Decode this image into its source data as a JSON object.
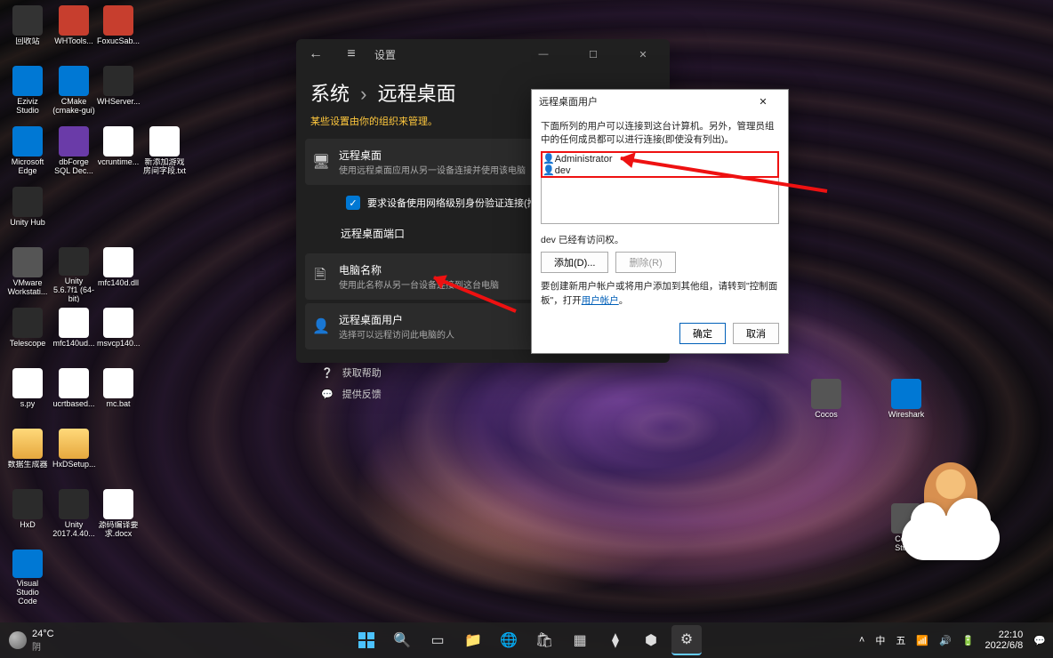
{
  "desktop": {
    "col1": [
      {
        "label": "回收站",
        "icon": "recycle"
      },
      {
        "label": "Eziviz Studio",
        "icon": "app-blue"
      },
      {
        "label": "Microsoft Edge",
        "icon": "app-blue"
      },
      {
        "label": "Unity Hub",
        "icon": "app-dark"
      },
      {
        "label": "VMware Workstati...",
        "icon": "app-grey"
      },
      {
        "label": "Telescope",
        "icon": "app-dark"
      },
      {
        "label": "s.py",
        "icon": "file"
      },
      {
        "label": "数据生成器",
        "icon": "folder"
      },
      {
        "label": "HxD",
        "icon": "app-dark"
      },
      {
        "label": "Visual Studio Code",
        "icon": "app-blue"
      }
    ],
    "col2": [
      {
        "label": "WHTools...",
        "icon": "app-red"
      },
      {
        "label": "CMake (cmake-gui)",
        "icon": "app-blue"
      },
      {
        "label": "dbForge SQL Dec...",
        "icon": "app-purple"
      },
      {
        "label": "",
        "icon": ""
      },
      {
        "label": "Unity 5.6.7f1 (64-bit)",
        "icon": "app-dark"
      },
      {
        "label": "mfc140ud...",
        "icon": "file"
      },
      {
        "label": "ucrtbased...",
        "icon": "file"
      },
      {
        "label": "HxDSetup...",
        "icon": "folder"
      },
      {
        "label": "Unity 2017.4.40...",
        "icon": "app-dark"
      }
    ],
    "col3": [
      {
        "label": "FoxucSab...",
        "icon": "app-red"
      },
      {
        "label": "WHServer...",
        "icon": "app-dark"
      },
      {
        "label": "vcruntime...",
        "icon": "file"
      },
      {
        "label": "",
        "icon": ""
      },
      {
        "label": "mfc140d.dll",
        "icon": "file"
      },
      {
        "label": "msvcp140...",
        "icon": "file"
      },
      {
        "label": "mc.bat",
        "icon": "file"
      },
      {
        "label": "",
        "icon": ""
      },
      {
        "label": "源码编译要求.docx",
        "icon": "file"
      }
    ],
    "col4": [
      {
        "label": "",
        "icon": ""
      },
      {
        "label": "",
        "icon": ""
      },
      {
        "label": "新添加游戏房间字段.txt",
        "icon": "file"
      }
    ],
    "right": [
      {
        "label": "Cocos",
        "icon": "app-grey"
      },
      {
        "label": "Wireshark",
        "icon": "app-blue"
      }
    ],
    "cocos2": {
      "label": "Cocos Studio",
      "icon": "app-grey"
    }
  },
  "settings": {
    "app_title": "设置",
    "breadcrumb_root": "系统",
    "breadcrumb_page": "远程桌面",
    "org_warning": "某些设置由你的组织来管理。",
    "rows": {
      "rd": {
        "title": "远程桌面",
        "sub": "使用远程桌面应用从另一设备连接并使用该电脑"
      },
      "nla": "要求设备使用网络级别身份验证连接(推荐)",
      "port": "远程桌面端口",
      "pcname": {
        "title": "电脑名称",
        "sub": "使用此名称从另一台设备连接到这台电脑"
      },
      "users": {
        "title": "远程桌面用户",
        "sub": "选择可以远程访问此电脑的人"
      }
    },
    "help": {
      "get": "获取帮助",
      "feedback": "提供反馈"
    }
  },
  "dialog": {
    "title": "远程桌面用户",
    "desc": "下面所列的用户可以连接到这台计算机。另外，管理员组中的任何成员都可以进行连接(即使没有列出)。",
    "users": [
      "Administrator",
      "dev"
    ],
    "access_note": "dev 已经有访问权。",
    "add_btn": "添加(D)...",
    "remove_btn": "删除(R)",
    "create_note_pre": "要创建新用户帐户或将用户添加到其他组，请转到\"控制面板\"，打开",
    "create_note_link": "用户帐户",
    "create_note_post": "。",
    "ok": "确定",
    "cancel": "取消"
  },
  "taskbar": {
    "weather_temp": "24°C",
    "weather_desc": "阴",
    "tray": {
      "ime1": "中",
      "ime2": "五"
    },
    "time": "22:10",
    "date": "2022/6/8"
  }
}
